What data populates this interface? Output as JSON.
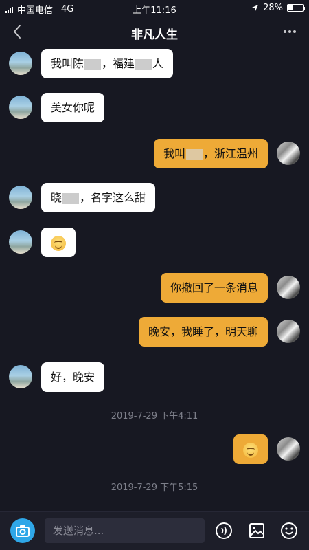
{
  "status_bar": {
    "carrier": "中国电信",
    "network": "4G",
    "time": "上午11:16",
    "battery": "28%",
    "battery_level": 0.28
  },
  "nav": {
    "title": "非凡人生",
    "back_icon": "chevron-left-icon",
    "more_icon": "more-dots-icon"
  },
  "messages": [
    {
      "side": "peer",
      "parts": [
        "我叫陈",
        "[blur]",
        "，福建",
        "[blur]",
        "人"
      ]
    },
    {
      "side": "peer",
      "parts": [
        "美女你呢"
      ]
    },
    {
      "side": "self",
      "parts": [
        "我叫",
        "[blur]",
        "，浙江温州"
      ]
    },
    {
      "side": "peer",
      "parts": [
        "晓",
        "[blur]",
        "，名字这么甜"
      ]
    },
    {
      "side": "peer",
      "parts": [
        "[emoji]"
      ]
    },
    {
      "side": "self",
      "parts": [
        "你撤回了一条消息"
      ]
    },
    {
      "side": "self",
      "parts": [
        "晚安，我睡了，明天聊"
      ]
    },
    {
      "side": "peer",
      "parts": [
        "好，晚安"
      ]
    },
    {
      "timestamp": "2019-7-29 下午4:11"
    },
    {
      "side": "self",
      "parts": [
        "[emoji]"
      ]
    },
    {
      "timestamp": "2019-7-29 下午5:15"
    }
  ],
  "input_bar": {
    "placeholder": "发送消息...",
    "icons": [
      "camera-icon",
      "voice-icon",
      "image-icon",
      "emoji-icon"
    ]
  },
  "colors": {
    "background": "#171822",
    "self_bubble": "#eeaa37",
    "peer_bubble": "#ffffff",
    "camera_button": "#2fa7e8"
  }
}
